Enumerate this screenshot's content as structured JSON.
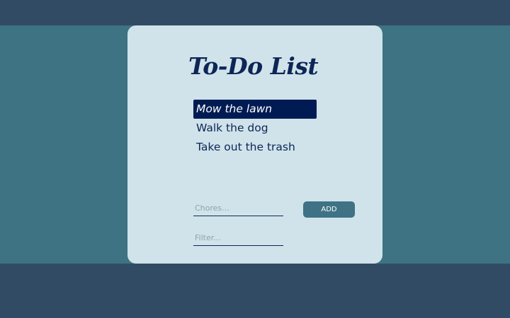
{
  "app": {
    "title": "To-Do List"
  },
  "todos": [
    {
      "label": "Mow the lawn",
      "selected": true
    },
    {
      "label": "Walk the dog",
      "selected": false
    },
    {
      "label": "Take out the trash",
      "selected": false
    }
  ],
  "form": {
    "chores_placeholder": "Chores...",
    "chores_value": "",
    "add_label": "ADD",
    "filter_placeholder": "Filter...",
    "filter_value": ""
  },
  "colors": {
    "page_background": "#324b64",
    "band_background": "#3d7382",
    "card_background": "#d0e3ea",
    "text": "#0d2656",
    "selected_background": "#001b53",
    "button_background": "#3e7284"
  }
}
